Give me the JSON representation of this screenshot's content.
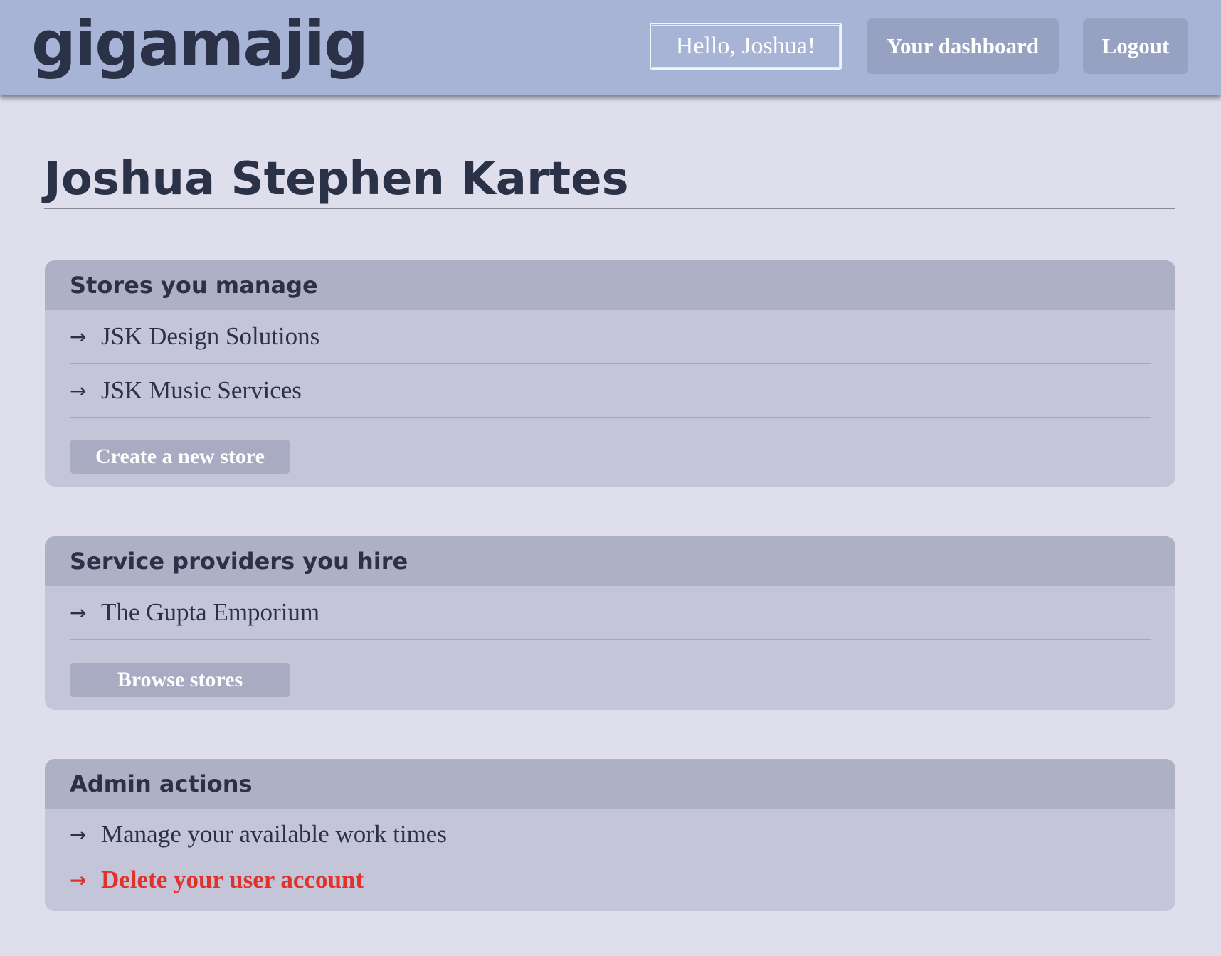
{
  "header": {
    "logo": "gigamajig",
    "greeting": "Hello, Joshua!",
    "dashboard_label": "Your dashboard",
    "logout_label": "Logout"
  },
  "page": {
    "title": "Joshua Stephen Kartes"
  },
  "stores": {
    "heading": "Stores you manage",
    "items": [
      {
        "label": "JSK Design Solutions"
      },
      {
        "label": "JSK Music Services"
      }
    ],
    "button_label": "Create a new store"
  },
  "providers": {
    "heading": "Service providers you hire",
    "items": [
      {
        "label": "The Gupta Emporium"
      }
    ],
    "button_label": "Browse stores"
  },
  "admin": {
    "heading": "Admin actions",
    "items": [
      {
        "label": "Manage your available work times"
      },
      {
        "label": "Delete your user account"
      }
    ]
  },
  "icons": {
    "arrow": "→"
  },
  "colors": {
    "header_bg": "#a8b4d6",
    "page_bg": "#dedeec",
    "card_bg": "#c4c5d8",
    "card_head_bg": "#aeb1c6",
    "text": "#2b3247",
    "danger": "#e0312a"
  }
}
